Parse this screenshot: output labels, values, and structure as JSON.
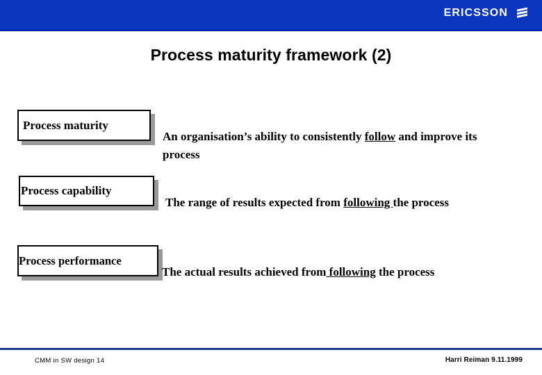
{
  "header": {
    "brand_name": "ERICSSON",
    "brand_color": "#0A35BE",
    "logo_icon": "ericsson-three-stripes-icon"
  },
  "slide": {
    "title": "Process maturity framework (2)",
    "rows": [
      {
        "term": "Process maturity",
        "definition_pre": "An organisation’s ability to consistently ",
        "definition_underlined": "follow",
        "definition_post": " and improve its process"
      },
      {
        "term": "Process capability",
        "definition_pre": "The range of results expected from ",
        "definition_underlined": "following ",
        "definition_post": "the process"
      },
      {
        "term": "Process performance",
        "definition_pre": "The actual results achieved from",
        "definition_underlined": " following",
        "definition_post": " the process"
      }
    ]
  },
  "footer": {
    "left_text": "CMM in SW design  14",
    "right_text": "Harri Reiman 9.11.1999",
    "rule_color": "#1b3a8c"
  }
}
